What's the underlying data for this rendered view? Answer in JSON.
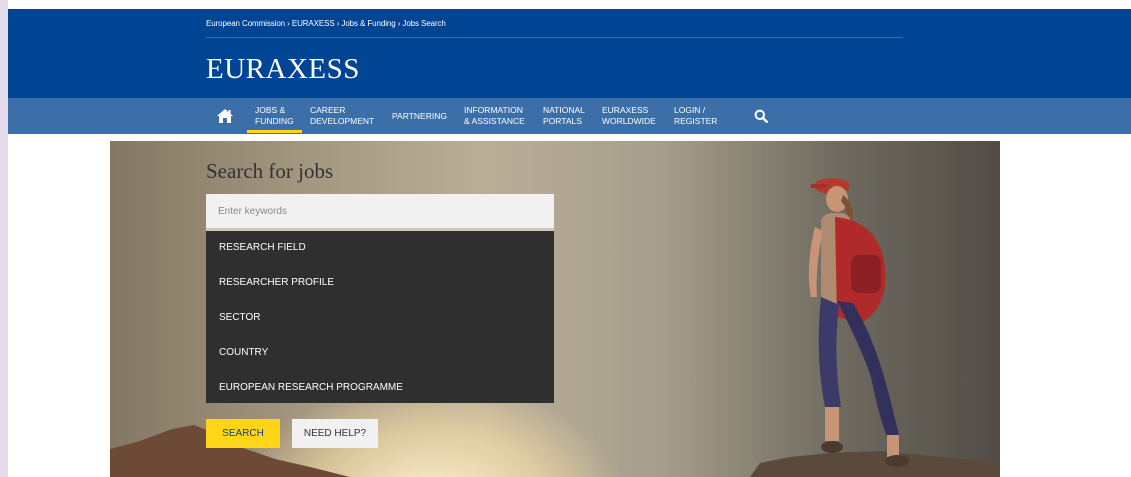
{
  "breadcrumb": {
    "text": "European Commission › EURAXESS › Jobs & Funding › Jobs Search"
  },
  "site": {
    "title": "EURAXESS"
  },
  "nav": {
    "home_icon": "home-icon",
    "items": [
      {
        "line1": "JOBS &",
        "line2": "FUNDING",
        "active": true
      },
      {
        "line1": "CAREER",
        "line2": "DEVELOPMENT"
      },
      {
        "line1": "PARTNERING",
        "line2": ""
      },
      {
        "line1": "INFORMATION",
        "line2": "& ASSISTANCE"
      },
      {
        "line1": "NATIONAL",
        "line2": "PORTALS"
      },
      {
        "line1": "EURAXESS",
        "line2": "WORLDWIDE"
      },
      {
        "line1": "LOGIN /",
        "line2": "REGISTER"
      }
    ],
    "search_icon": "search-icon"
  },
  "search": {
    "heading": "Search for jobs",
    "keywords_placeholder": "Enter keywords",
    "keywords_value": "",
    "filters": [
      "RESEARCH FIELD",
      "RESEARCHER PROFILE",
      "SECTOR",
      "COUNTRY",
      "EUROPEAN RESEARCH PROGRAMME"
    ],
    "search_button": "SEARCH",
    "help_button": "NEED HELP?"
  },
  "colors": {
    "brand_blue": "#004494",
    "nav_blue": "#3c6fa8",
    "accent_yellow": "#ffd617",
    "panel_dark": "#2f2f2f"
  }
}
